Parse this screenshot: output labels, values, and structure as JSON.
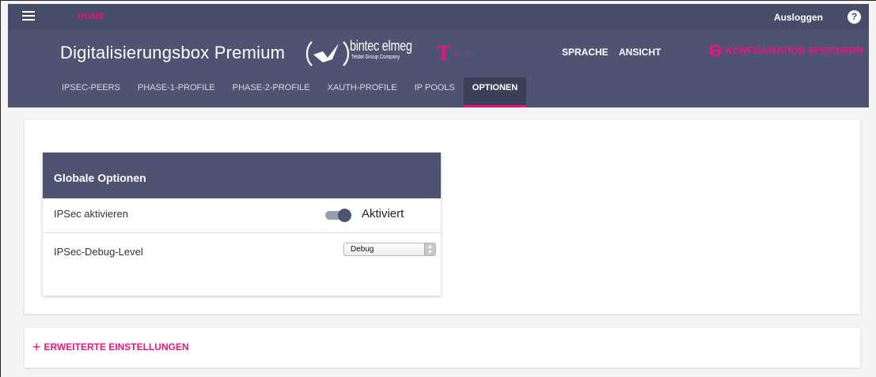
{
  "topbar": {
    "home_label": "HOME",
    "logout_label": "Ausloggen",
    "help_glyph": "?"
  },
  "header": {
    "app_title": "Digitalisierungsbox Premium",
    "brand_name": "bintec elmeg",
    "brand_sub": "Teldat Group Company",
    "t_logo": "T",
    "t_dots": "• •",
    "language_label": "SPRACHE",
    "view_label": "ANSICHT",
    "save_label": "KONFIGURATION SPEICHERN"
  },
  "tabs": [
    {
      "label": "IPSEC-PEERS",
      "active": false
    },
    {
      "label": "PHASE-1-PROFILE",
      "active": false
    },
    {
      "label": "PHASE-2-PROFILE",
      "active": false
    },
    {
      "label": "XAUTH-PROFILE",
      "active": false
    },
    {
      "label": "IP POOLS",
      "active": false
    },
    {
      "label": "OPTIONEN",
      "active": true
    }
  ],
  "panel": {
    "title": "Globale Optionen",
    "ipsec_label": "IPSec aktivieren",
    "ipsec_toggle_state": "Aktiviert",
    "debug_label": "IPSec-Debug-Level",
    "debug_value": "Debug"
  },
  "advanced": {
    "plus": "+",
    "label": "ERWEITERTE EINSTELLUNGEN"
  },
  "colors": {
    "accent": "#e6157d",
    "header_bg": "#4e5372",
    "topbar_bg": "#474c68"
  }
}
